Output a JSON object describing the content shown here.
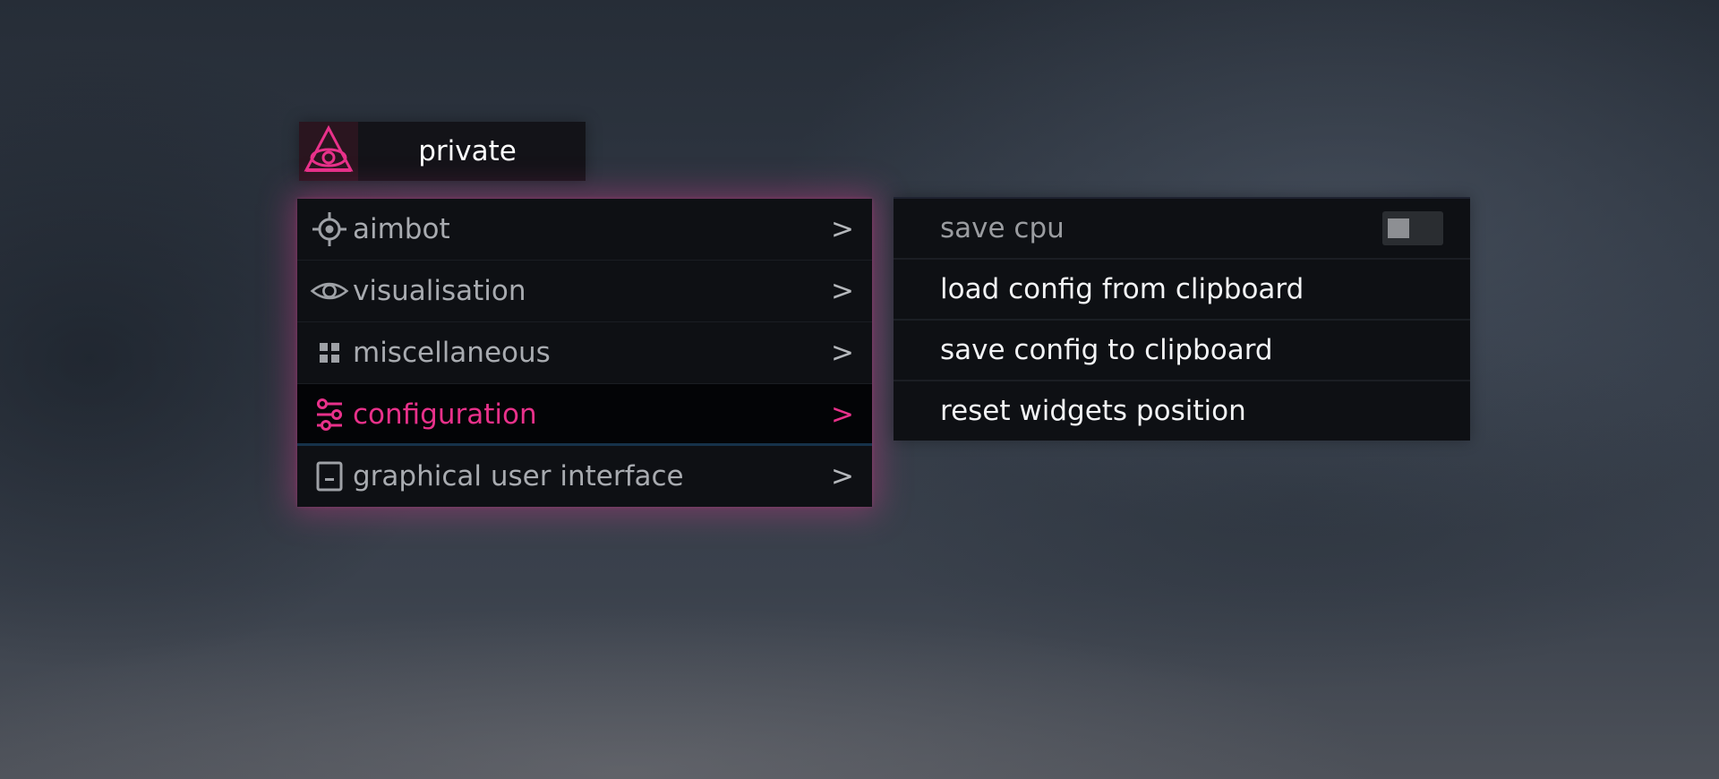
{
  "header": {
    "logo_icon": "all-seeing-eye-triangle-icon",
    "title": "private",
    "accent_color": "#e8318a"
  },
  "main_menu": {
    "items": [
      {
        "label": "aimbot",
        "icon": "crosshair-icon",
        "arrow": ">",
        "active": false
      },
      {
        "label": "visualisation",
        "icon": "eye-icon",
        "arrow": ">",
        "active": false
      },
      {
        "label": "miscellaneous",
        "icon": "grid-icon",
        "arrow": ">",
        "active": false
      },
      {
        "label": "configuration",
        "icon": "sliders-icon",
        "arrow": ">",
        "active": true
      },
      {
        "label": "graphical user interface",
        "icon": "window-icon",
        "arrow": ">",
        "active": false
      }
    ]
  },
  "sub_menu": {
    "items": [
      {
        "label": "save cpu",
        "type": "toggle",
        "enabled": false
      },
      {
        "label": "load config from clipboard",
        "type": "button"
      },
      {
        "label": "save config to clipboard",
        "type": "button"
      },
      {
        "label": "reset widgets position",
        "type": "button"
      }
    ]
  }
}
